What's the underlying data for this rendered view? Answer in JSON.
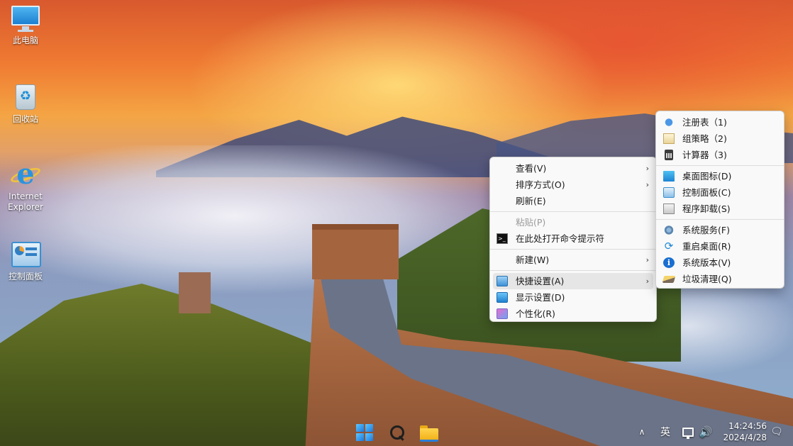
{
  "desktop": {
    "icons": [
      {
        "label": "此电脑",
        "icon": "computer-icon"
      },
      {
        "label": "回收站",
        "icon": "recycle-bin-icon"
      },
      {
        "label": "Internet Explorer",
        "icon": "internet-explorer-icon"
      },
      {
        "label": "控制面板",
        "icon": "control-panel-icon"
      }
    ]
  },
  "context_menu": {
    "items": [
      {
        "label": "查看(V)",
        "has_submenu": true
      },
      {
        "label": "排序方式(O)",
        "has_submenu": true
      },
      {
        "label": "刷新(E)"
      },
      {
        "label": "粘贴(P)",
        "disabled": true
      },
      {
        "label": "在此处打开命令提示符",
        "icon": "command-prompt-icon"
      },
      {
        "label": "新建(W)",
        "has_submenu": true
      },
      {
        "label": "快捷设置(A)",
        "icon": "quick-settings-icon",
        "has_submenu": true,
        "highlighted": true
      },
      {
        "label": "显示设置(D)",
        "icon": "display-settings-icon"
      },
      {
        "label": "个性化(R)",
        "icon": "personalize-icon"
      }
    ],
    "arrow": "›"
  },
  "submenu": {
    "items": [
      {
        "label": "注册表（1)",
        "icon": "registry-icon"
      },
      {
        "label": "组策略（2)",
        "icon": "group-policy-icon"
      },
      {
        "label": "计算器（3)",
        "icon": "calculator-icon"
      },
      {
        "label": "桌面图标(D)",
        "icon": "desktop-icons-icon"
      },
      {
        "label": "控制面板(C)",
        "icon": "control-panel-icon"
      },
      {
        "label": "程序卸载(S)",
        "icon": "uninstall-icon"
      },
      {
        "label": "系统服务(F)",
        "icon": "services-icon"
      },
      {
        "label": "重启桌面(R)",
        "icon": "restart-icon"
      },
      {
        "label": "系统版本(V)",
        "icon": "info-icon"
      },
      {
        "label": "垃圾清理(Q)",
        "icon": "cleanup-icon"
      }
    ]
  },
  "taskbar": {
    "apps": [
      {
        "name": "start",
        "icon": "windows-start-icon"
      },
      {
        "name": "search",
        "icon": "search-icon"
      },
      {
        "name": "file-explorer",
        "icon": "folder-icon"
      }
    ],
    "tray": {
      "overflow_glyph": "∧",
      "ime": "英",
      "volume_glyph": "🔊",
      "time": "14:24:56",
      "date": "2024/4/28",
      "notification_glyph": "🗨"
    }
  },
  "icon_glyphs": {
    "recycle": "♻",
    "restart": "⟳",
    "info": "i"
  }
}
